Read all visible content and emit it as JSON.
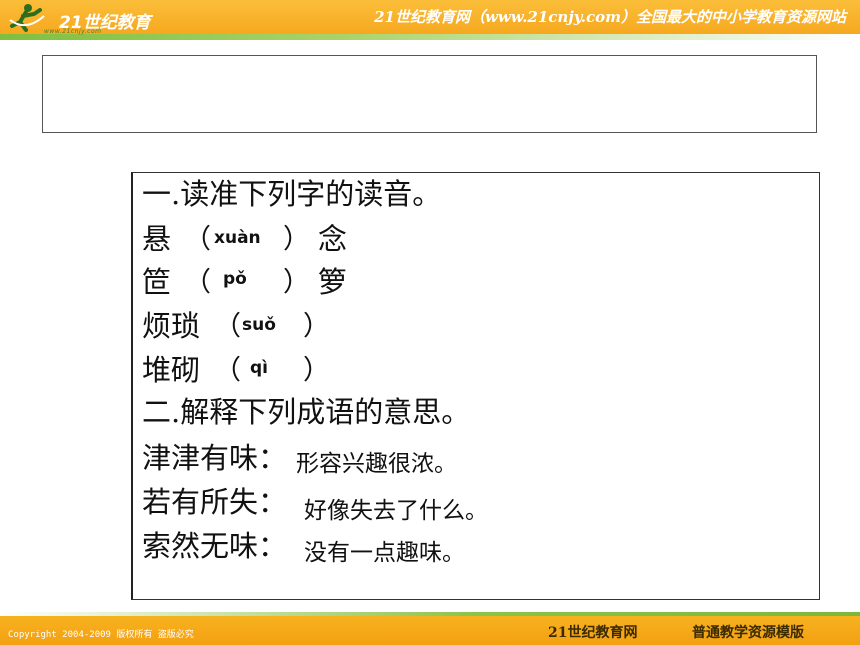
{
  "header": {
    "logo_text": "21世纪教育",
    "logo_url": "www.21cnjy.com",
    "slogan": "21世纪教育网（www.21cnjy.com）全国最大的中小学教育资源网站"
  },
  "title_box": {
    "text": ""
  },
  "content": {
    "section1_title": "一.读准下列字的读音。",
    "items": [
      {
        "before": "悬（",
        "pinyin": "xuàn",
        "after": "）念"
      },
      {
        "before": "筐（",
        "pinyin": "pǒ",
        "after": "）箩"
      },
      {
        "before": "烦琐（",
        "pinyin": "suǒ",
        "after": "）"
      },
      {
        "before": "堆砌（",
        "pinyin": "qì",
        "after": "）"
      }
    ],
    "section2_title": "二.解释下列成语的意思。",
    "idioms": [
      {
        "term": "津津有味：",
        "meaning": "形容兴趣很浓。"
      },
      {
        "term": "若有所失：",
        "meaning": "好像失去了什么。"
      },
      {
        "term": "索然无味：",
        "meaning": "没有一点趣味。"
      }
    ]
  },
  "footer": {
    "copyright": "Copyright 2004-2009 版权所有 盗版必究",
    "brand": "21世纪教育网",
    "template": "普通教学资源模版"
  }
}
